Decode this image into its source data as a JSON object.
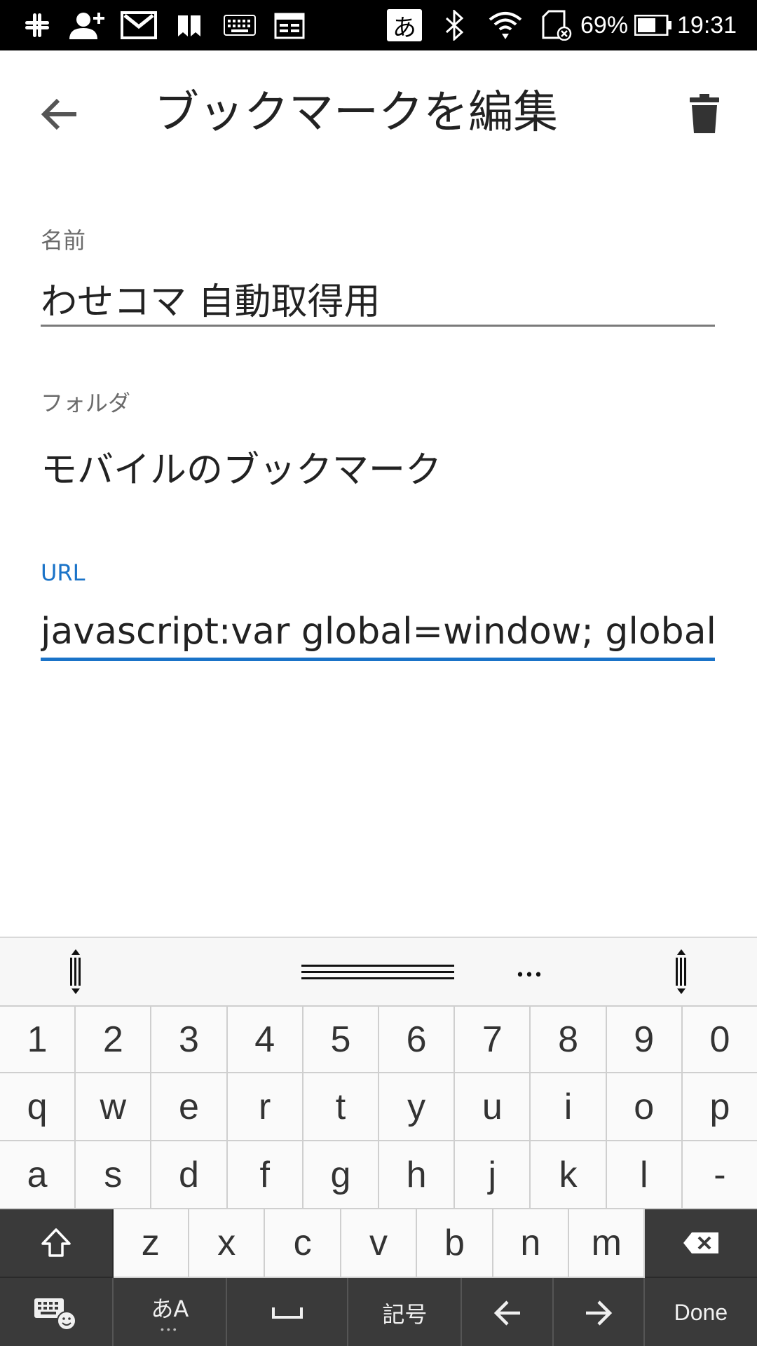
{
  "status_bar": {
    "icons": [
      "slack-icon",
      "add-person-icon",
      "gmail-icon",
      "bookmark-icon",
      "keyboard-icon",
      "calendar-icon",
      "ime-icon",
      "bluetooth-icon",
      "wifi-icon",
      "sd-card-icon",
      "battery-icon"
    ],
    "ime_char": "あ",
    "battery": "69%",
    "time": "19:31"
  },
  "app_bar": {
    "title": "ブックマークを編集"
  },
  "form": {
    "name_label": "名前",
    "name_value": "わせコマ 自動取得用",
    "folder_label": "フォルダ",
    "folder_value": "モバイルのブックマーク",
    "url_label": "URL",
    "url_value": "javascript:var global=window; global.COR"
  },
  "keyboard": {
    "number_row": [
      "1",
      "2",
      "3",
      "4",
      "5",
      "6",
      "7",
      "8",
      "9",
      "0"
    ],
    "row_q": [
      "q",
      "w",
      "e",
      "r",
      "t",
      "y",
      "u",
      "i",
      "o",
      "p"
    ],
    "row_a": [
      "a",
      "s",
      "d",
      "f",
      "g",
      "h",
      "j",
      "k",
      "l",
      "-"
    ],
    "row_z": [
      "z",
      "x",
      "c",
      "v",
      "b",
      "n",
      "m"
    ],
    "toolbar_more": "•••",
    "lang_key": "あA",
    "symbol_key": "記号",
    "done_key": "Done"
  },
  "colors": {
    "accent": "#1a73c8",
    "statusbar_bg": "#000000",
    "keyboard_dark": "#3a3a3a"
  }
}
